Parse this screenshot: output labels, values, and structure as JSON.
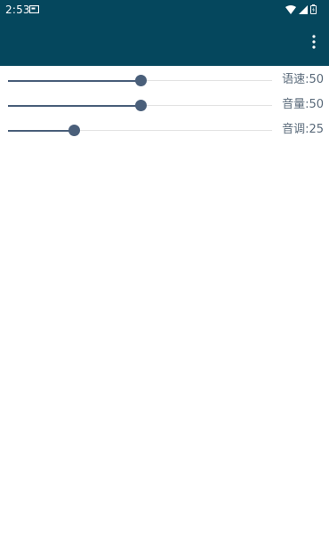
{
  "status_bar": {
    "time": "2:53",
    "icons": [
      "notification-icon",
      "wifi-icon",
      "signal-icon",
      "battery-icon"
    ]
  },
  "toolbar": {
    "menu_icon": "more-vert-icon"
  },
  "settings": [
    {
      "label": "语速:50",
      "value": 50,
      "max": 100
    },
    {
      "label": "音量:50",
      "value": 50,
      "max": 100
    },
    {
      "label": "音调:25",
      "value": 25,
      "max": 100
    }
  ],
  "colors": {
    "app_bar": "#05475d",
    "slider_active": "#4a5f7a",
    "slider_track": "#e3e3e3",
    "label_text": "#5a6a7a"
  }
}
